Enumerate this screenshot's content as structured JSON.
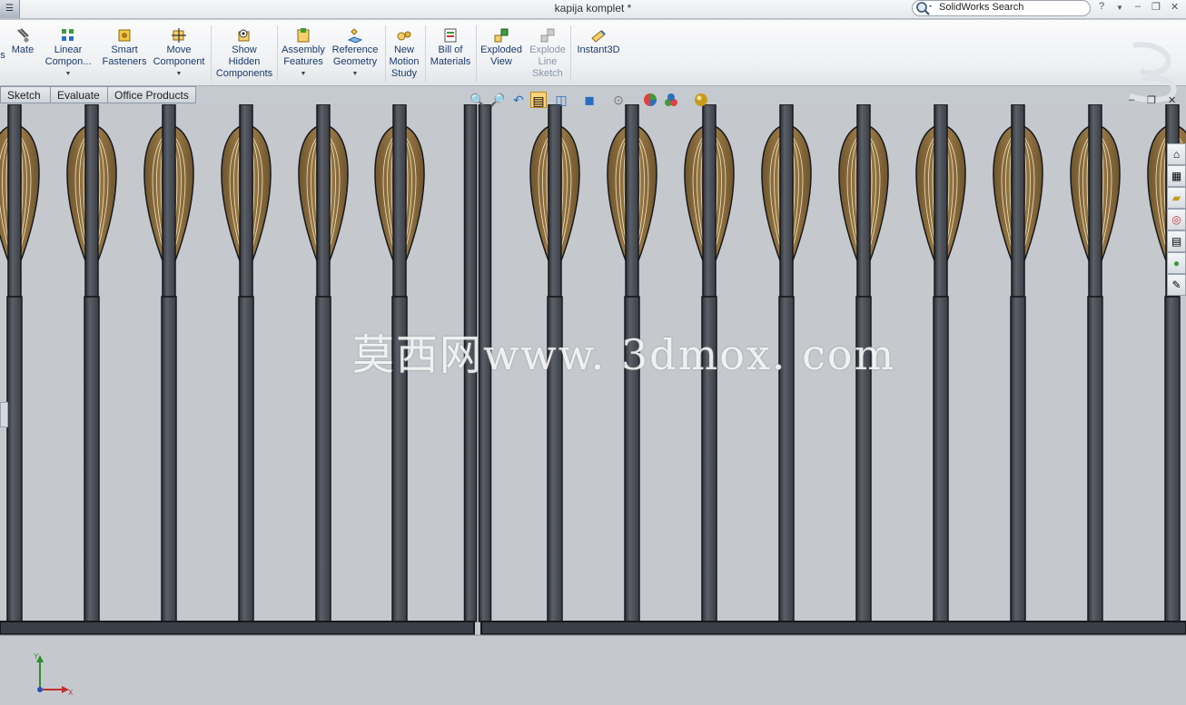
{
  "window": {
    "title": "kapija komplet *",
    "search_placeholder": "SolidWorks Search",
    "help": "?",
    "ctrl_min": "–",
    "ctrl_restore": "❐",
    "ctrl_close": "✕"
  },
  "ribbon": {
    "partial_left": "s",
    "buttons": [
      {
        "label": "Mate",
        "icon": "mate-icon",
        "dropdown": false,
        "enabled": true
      },
      {
        "label": "Linear\nCompon...",
        "icon": "linear-pattern-icon",
        "dropdown": true,
        "enabled": true
      },
      {
        "label": "Smart\nFasteners",
        "icon": "smart-fasteners-icon",
        "dropdown": false,
        "enabled": true
      },
      {
        "label": "Move\nComponent",
        "icon": "move-component-icon",
        "dropdown": true,
        "enabled": true
      },
      {
        "label": "Show\nHidden\nComponents",
        "icon": "show-hidden-icon",
        "dropdown": false,
        "enabled": true
      },
      {
        "label": "Assembly\nFeatures",
        "icon": "assembly-features-icon",
        "dropdown": true,
        "enabled": true
      },
      {
        "label": "Reference\nGeometry",
        "icon": "reference-geometry-icon",
        "dropdown": true,
        "enabled": true
      },
      {
        "label": "New\nMotion\nStudy",
        "icon": "motion-study-icon",
        "dropdown": false,
        "enabled": true
      },
      {
        "label": "Bill of\nMaterials",
        "icon": "bom-icon",
        "dropdown": false,
        "enabled": true
      },
      {
        "label": "Exploded\nView",
        "icon": "exploded-view-icon",
        "dropdown": false,
        "enabled": true
      },
      {
        "label": "Explode\nLine\nSketch",
        "icon": "explode-line-icon",
        "dropdown": false,
        "enabled": false
      },
      {
        "label": "Instant3D",
        "icon": "instant3d-icon",
        "dropdown": false,
        "enabled": true
      }
    ]
  },
  "tabs": [
    {
      "label": "Sketch"
    },
    {
      "label": "Evaluate"
    },
    {
      "label": "Office Products"
    }
  ],
  "heads_up_toolbar": [
    "zoom-to-fit-icon",
    "zoom-area-icon",
    "previous-view-icon",
    "section-view-icon",
    "view-orientation-icon",
    "display-style-icon",
    "hide-show-icon",
    "appearance-icon",
    "scene-icon",
    "realview-icon"
  ],
  "viewport_controls": {
    "minimize": "–",
    "restore": "❐",
    "close": "✕"
  },
  "task_pane": [
    "home-icon",
    "design-library-icon",
    "file-explorer-icon",
    "search-results-icon",
    "view-palette-icon",
    "appearances-icon",
    "custom-properties-icon"
  ],
  "watermark": "莫西网www. 3dmox. com",
  "triad": {
    "y": "Y",
    "x": "X"
  },
  "colors": {
    "viewport_bg": "#c5c9ce",
    "bar_fill": "#4b4f57",
    "bar_edge": "#16181c",
    "bar_highlight": "#8b8f97",
    "leaf_fill": "#8a6b3e",
    "leaf_line": "#f2e4c2",
    "rail_fill": "#3a3e46"
  }
}
